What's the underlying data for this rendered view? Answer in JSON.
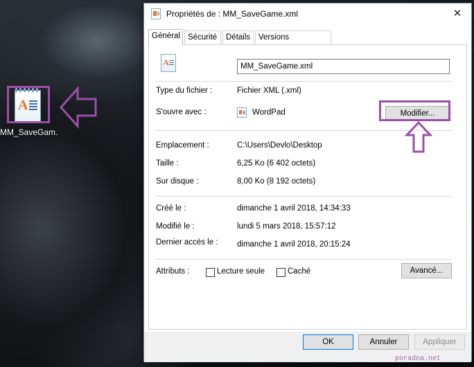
{
  "desktop": {
    "icon_label": "MM_SaveGam...",
    "icon": "wordpad-document-icon"
  },
  "dialog": {
    "title": "Propriétés de : MM_SaveGame.xml",
    "close_glyph": "✕",
    "tabs": [
      {
        "label": "Général",
        "active": true
      },
      {
        "label": "Sécurité",
        "active": false
      },
      {
        "label": "Détails",
        "active": false
      },
      {
        "label": "Versions précédentes",
        "active": false
      }
    ],
    "general": {
      "file_name": "MM_SaveGame.xml",
      "type_label": "Type du fichier :",
      "type_value": "Fichier XML (.xml)",
      "opens_label": "S'ouvre avec :",
      "opens_value": "WordPad",
      "modify_button": "Modifier...",
      "location_label": "Emplacement :",
      "location_value": "C:\\Users\\Devlo\\Desktop",
      "size_label": "Taille :",
      "size_value": "6,25 Ko (6 402 octets)",
      "disk_label": "Sur disque :",
      "disk_value": "8,00 Ko (8 192 octets)",
      "created_label": "Créé le :",
      "created_value": "dimanche 1 avril 2018, 14:34:33",
      "modified_label": "Modifié le :",
      "modified_value": "lundi 5 mars 2018, 15:57:12",
      "accessed_label": "Dernier accès le :",
      "accessed_value": "dimanche 1 avril 2018, 20:15:24",
      "attributes_label": "Attributs :",
      "readonly_label": "Lecture seule",
      "readonly_checked": false,
      "hidden_label": "Caché",
      "hidden_checked": false,
      "advanced_button": "Avancé..."
    },
    "footer": {
      "ok": "OK",
      "cancel": "Annuler",
      "apply": "Appliquer"
    }
  },
  "annotations": {
    "highlight_color": "#9b4fa8"
  },
  "watermark": "poradna.net"
}
